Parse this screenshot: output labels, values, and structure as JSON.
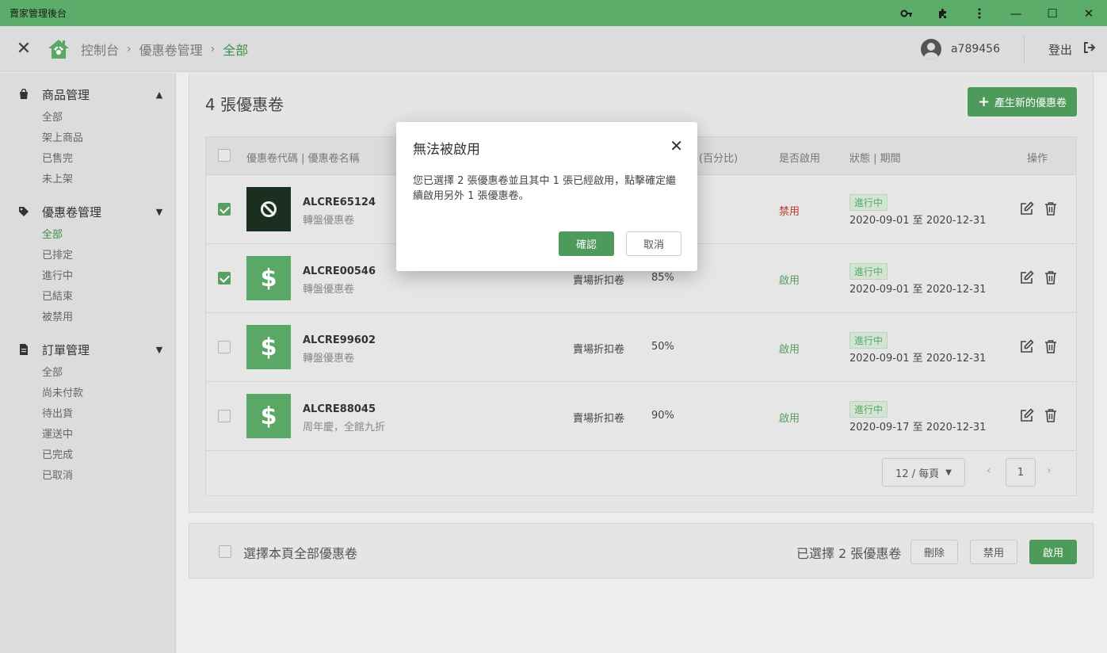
{
  "app": {
    "title": "賣家管理後台"
  },
  "titlebar_icons": [
    "key-icon",
    "puzzle-icon",
    "more-vertical-icon"
  ],
  "window_controls": {
    "minimize": "—",
    "maximize": "☐",
    "close": "✕"
  },
  "breadcrumb": {
    "items": [
      "控制台",
      "優惠卷管理",
      "全部"
    ],
    "separator": "›"
  },
  "user": {
    "name": "a789456",
    "logout_label": "登出"
  },
  "sidebar": {
    "sections": [
      {
        "title": "商品管理",
        "icon": "shopping-bag-icon",
        "chevron": "▲",
        "items": [
          "全部",
          "架上商品",
          "已售完",
          "未上架"
        ],
        "active": -1
      },
      {
        "title": "優惠卷管理",
        "icon": "tag-icon",
        "chevron": "▼",
        "items": [
          "全部",
          "已排定",
          "進行中",
          "已結束",
          "被禁用"
        ],
        "active": 0
      },
      {
        "title": "訂單管理",
        "icon": "file-icon",
        "chevron": "▼",
        "items": [
          "全部",
          "尚未付款",
          "待出貨",
          "運送中",
          "已完成",
          "已取消"
        ],
        "active": -1
      }
    ]
  },
  "main": {
    "count_title": "4 張優惠卷",
    "new_button_label": "產生新的優惠卷",
    "table": {
      "headers": {
        "code_name": "優惠卷代碼 | 優惠卷名稱",
        "discount": "(百分比)",
        "enabled": "是否啟用",
        "status_period": "狀態 | 期間",
        "actions": "操作"
      },
      "rows": [
        {
          "checked": true,
          "thumb": "disabled",
          "code": "ALCRE65124",
          "name": "轉盤優惠卷",
          "type": "",
          "percent": "",
          "enabled": "禁用",
          "status": "進行中",
          "period": "2020-09-01 至 2020-12-31"
        },
        {
          "checked": true,
          "thumb": "dollar",
          "code": "ALCRE00546",
          "name": "轉盤優惠卷",
          "type": "賣場折扣卷",
          "percent": "85%",
          "enabled": "啟用",
          "status": "進行中",
          "period": "2020-09-01 至 2020-12-31"
        },
        {
          "checked": false,
          "thumb": "dollar",
          "code": "ALCRE99602",
          "name": "轉盤優惠卷",
          "type": "賣場折扣卷",
          "percent": "50%",
          "enabled": "啟用",
          "status": "進行中",
          "period": "2020-09-01 至 2020-12-31"
        },
        {
          "checked": false,
          "thumb": "dollar",
          "code": "ALCRE88045",
          "name": "周年慶，全館九折",
          "type": "賣場折扣卷",
          "percent": "90%",
          "enabled": "啟用",
          "status": "進行中",
          "period": "2020-09-17 至 2020-12-31"
        }
      ]
    },
    "pagination": {
      "page_size": "12 / 每頁",
      "current_page": "1",
      "prev": "‹",
      "next": "›"
    }
  },
  "footer": {
    "select_all_label": "選擇本頁全部優惠卷",
    "selected_count": "已選擇 2 張優惠卷",
    "delete_label": "刪除",
    "disable_label": "禁用",
    "enable_label": "啟用"
  },
  "modal": {
    "title": "無法被啟用",
    "body": "您已選擇 2 張優惠卷並且其中 1 張已經啟用，點擊確定繼續啟用另外 1 張優惠卷。",
    "confirm_label": "確認",
    "cancel_label": "取消",
    "close_label": "✕"
  },
  "colors": {
    "primary": "#4d9a5a",
    "active_text": "#3f8f4c",
    "disabled_text": "#c0392b",
    "enabled_text": "#5a9a63"
  }
}
